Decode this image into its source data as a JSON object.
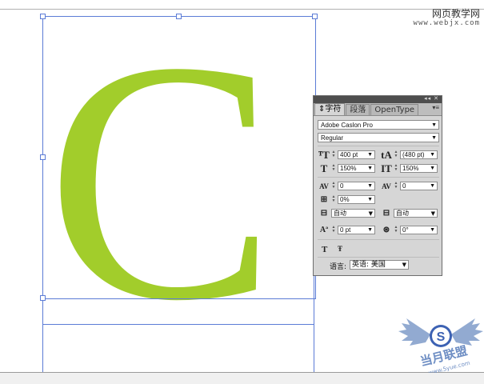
{
  "watermark_site": {
    "name": "网页教学网",
    "url": "www.webjx.com"
  },
  "canvas": {
    "glyph": "C",
    "glyph_color": "#a2cd2b",
    "selection_color": "#5b7cd6"
  },
  "panel": {
    "tabs": [
      {
        "label": "字符",
        "active": true
      },
      {
        "label": "段落",
        "active": false
      },
      {
        "label": "OpenType",
        "active": false
      }
    ],
    "font_family": "Adobe Caslon Pro",
    "font_style": "Regular",
    "font_size": "400 pt",
    "leading": "(480 pt)",
    "horizontal_scale": "150%",
    "vertical_scale": "150%",
    "kerning": "0",
    "tracking": "0",
    "tsume": "0%",
    "aki_left": "自动",
    "aki_right": "自动",
    "baseline_shift": "0 pt",
    "rotation": "0°",
    "language_label": "语言:",
    "language_value": "英语: 美国"
  },
  "bottom_watermark": {
    "text": "当月联盟",
    "url": "www.5yue.com",
    "badge": "S"
  }
}
